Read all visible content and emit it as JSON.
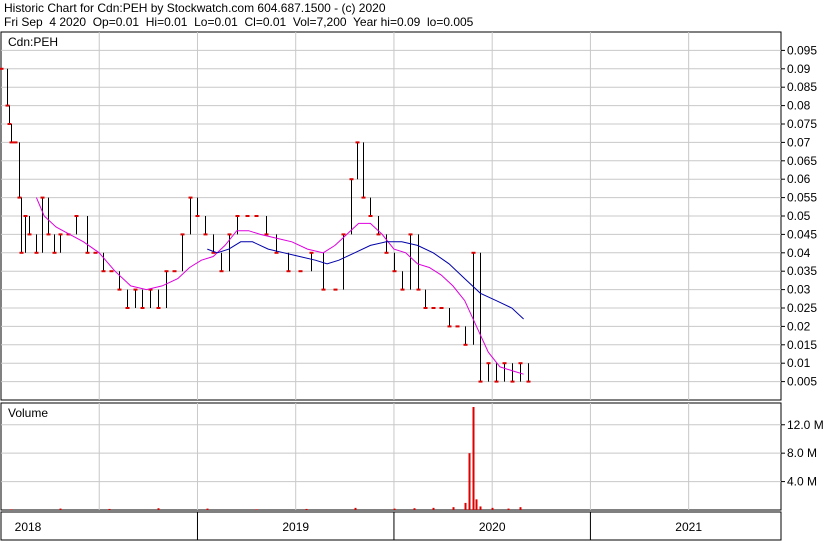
{
  "header": {
    "line1": "Historic Chart for Cdn:PEH by Stockwatch.com 604.687.1500 - (c) 2020",
    "line2": "Fri Sep  4 2020  Op=0.01  Hi=0.01  Lo=0.01  Cl=0.01  Vol=7,200  Year hi=0.09  lo=0.005"
  },
  "colors": {
    "price_up": "#000000",
    "price_down": "#dd0000",
    "ma_short": "#dd00dd",
    "ma_long": "#0000aa",
    "volume": "#dd0000",
    "grid": "#c8c8c8"
  },
  "chart_data": [
    {
      "type": "line",
      "title": "Cdn:PEH",
      "y_axis_side": "right",
      "ylim": [
        0,
        0.1
      ],
      "yticks": [
        "0.095",
        "0.09",
        "0.085",
        "0.08",
        "0.075",
        "0.07",
        "0.065",
        "0.06",
        "0.055",
        "0.05",
        "0.045",
        "0.04",
        "0.035",
        "0.03",
        "0.025",
        "0.02",
        "0.015",
        "0.01",
        "0.005"
      ],
      "grid": true,
      "series": [
        {
          "kind": "price-bars",
          "points": [
            [
              2018.0,
              0.09
            ],
            [
              2018.03,
              0.08
            ],
            [
              2018.04,
              0.075
            ],
            [
              2018.05,
              0.07
            ],
            [
              2018.07,
              0.07
            ],
            [
              2018.09,
              0.055
            ],
            [
              2018.1,
              0.04
            ],
            [
              2018.12,
              0.05
            ],
            [
              2018.14,
              0.045
            ],
            [
              2018.18,
              0.04
            ],
            [
              2018.21,
              0.055
            ],
            [
              2018.24,
              0.045
            ],
            [
              2018.27,
              0.04
            ],
            [
              2018.3,
              0.045
            ],
            [
              2018.34,
              0.045
            ],
            [
              2018.38,
              0.05
            ],
            [
              2018.44,
              0.04
            ],
            [
              2018.48,
              0.04
            ],
            [
              2018.52,
              0.035
            ],
            [
              2018.56,
              0.035
            ],
            [
              2018.6,
              0.03
            ],
            [
              2018.64,
              0.025
            ],
            [
              2018.68,
              0.03
            ],
            [
              2018.72,
              0.025
            ],
            [
              2018.76,
              0.03
            ],
            [
              2018.8,
              0.025
            ],
            [
              2018.84,
              0.035
            ],
            [
              2018.88,
              0.035
            ],
            [
              2018.92,
              0.045
            ],
            [
              2018.96,
              0.055
            ],
            [
              2019.0,
              0.05
            ],
            [
              2019.04,
              0.045
            ],
            [
              2019.08,
              0.04
            ],
            [
              2019.12,
              0.035
            ],
            [
              2019.16,
              0.045
            ],
            [
              2019.2,
              0.05
            ],
            [
              2019.25,
              0.05
            ],
            [
              2019.3,
              0.05
            ],
            [
              2019.35,
              0.045
            ],
            [
              2019.4,
              0.04
            ],
            [
              2019.46,
              0.035
            ],
            [
              2019.52,
              0.035
            ],
            [
              2019.58,
              0.04
            ],
            [
              2019.64,
              0.03
            ],
            [
              2019.7,
              0.03
            ],
            [
              2019.74,
              0.045
            ],
            [
              2019.78,
              0.06
            ],
            [
              2019.81,
              0.07
            ],
            [
              2019.84,
              0.055
            ],
            [
              2019.88,
              0.05
            ],
            [
              2019.92,
              0.045
            ],
            [
              2019.96,
              0.04
            ],
            [
              2020.0,
              0.035
            ],
            [
              2020.04,
              0.03
            ],
            [
              2020.08,
              0.045
            ],
            [
              2020.12,
              0.03
            ],
            [
              2020.16,
              0.025
            ],
            [
              2020.2,
              0.025
            ],
            [
              2020.24,
              0.025
            ],
            [
              2020.28,
              0.02
            ],
            [
              2020.32,
              0.02
            ],
            [
              2020.36,
              0.015
            ],
            [
              2020.4,
              0.04
            ],
            [
              2020.44,
              0.005
            ],
            [
              2020.48,
              0.01
            ],
            [
              2020.52,
              0.005
            ],
            [
              2020.56,
              0.01
            ],
            [
              2020.6,
              0.005
            ],
            [
              2020.64,
              0.01
            ],
            [
              2020.68,
              0.005
            ]
          ]
        },
        {
          "kind": "ma-short",
          "points": [
            [
              2018.18,
              0.055
            ],
            [
              2018.22,
              0.05
            ],
            [
              2018.28,
              0.047
            ],
            [
              2018.35,
              0.045
            ],
            [
              2018.42,
              0.043
            ],
            [
              2018.5,
              0.04
            ],
            [
              2018.58,
              0.035
            ],
            [
              2018.66,
              0.031
            ],
            [
              2018.74,
              0.03
            ],
            [
              2018.82,
              0.031
            ],
            [
              2018.9,
              0.033
            ],
            [
              2018.96,
              0.036
            ],
            [
              2019.02,
              0.038
            ],
            [
              2019.08,
              0.039
            ],
            [
              2019.14,
              0.042
            ],
            [
              2019.2,
              0.046
            ],
            [
              2019.26,
              0.046
            ],
            [
              2019.32,
              0.045
            ],
            [
              2019.4,
              0.044
            ],
            [
              2019.48,
              0.043
            ],
            [
              2019.56,
              0.041
            ],
            [
              2019.64,
              0.04
            ],
            [
              2019.7,
              0.042
            ],
            [
              2019.76,
              0.045
            ],
            [
              2019.82,
              0.048
            ],
            [
              2019.88,
              0.048
            ],
            [
              2019.94,
              0.045
            ],
            [
              2020.0,
              0.041
            ],
            [
              2020.06,
              0.04
            ],
            [
              2020.12,
              0.037
            ],
            [
              2020.18,
              0.036
            ],
            [
              2020.24,
              0.034
            ],
            [
              2020.3,
              0.031
            ],
            [
              2020.36,
              0.027
            ],
            [
              2020.42,
              0.02
            ],
            [
              2020.48,
              0.013
            ],
            [
              2020.54,
              0.009
            ],
            [
              2020.6,
              0.008
            ],
            [
              2020.66,
              0.007
            ]
          ]
        },
        {
          "kind": "ma-long",
          "points": [
            [
              2019.05,
              0.041
            ],
            [
              2019.1,
              0.04
            ],
            [
              2019.16,
              0.041
            ],
            [
              2019.22,
              0.043
            ],
            [
              2019.28,
              0.043
            ],
            [
              2019.36,
              0.041
            ],
            [
              2019.44,
              0.04
            ],
            [
              2019.52,
              0.039
            ],
            [
              2019.6,
              0.038
            ],
            [
              2019.66,
              0.037
            ],
            [
              2019.72,
              0.038
            ],
            [
              2019.8,
              0.04
            ],
            [
              2019.88,
              0.042
            ],
            [
              2019.96,
              0.043
            ],
            [
              2020.04,
              0.043
            ],
            [
              2020.12,
              0.042
            ],
            [
              2020.2,
              0.04
            ],
            [
              2020.28,
              0.037
            ],
            [
              2020.36,
              0.033
            ],
            [
              2020.44,
              0.029
            ],
            [
              2020.52,
              0.027
            ],
            [
              2020.6,
              0.025
            ],
            [
              2020.66,
              0.022
            ]
          ]
        }
      ]
    },
    {
      "type": "bar",
      "title": "Volume",
      "y_axis_side": "right",
      "ylim": [
        0,
        14.5
      ],
      "yticks": [
        "12.0 M",
        "8.0 M",
        "4.0 M"
      ],
      "unit": "M",
      "x": [
        2018.05,
        2018.3,
        2018.55,
        2018.8,
        2019.05,
        2019.3,
        2019.55,
        2019.8,
        2020.0,
        2020.1,
        2020.2,
        2020.3,
        2020.36,
        2020.38,
        2020.4,
        2020.42,
        2020.44,
        2020.5,
        2020.58,
        2020.64
      ],
      "values": [
        0.1,
        0.2,
        0.15,
        0.25,
        0.2,
        0.1,
        0.15,
        0.3,
        0.2,
        0.25,
        0.3,
        0.4,
        1.0,
        8.0,
        14.5,
        1.5,
        0.5,
        0.3,
        0.2,
        0.4
      ]
    }
  ],
  "x_axis": {
    "labels": [
      "2018",
      "2019",
      "2020",
      "2021"
    ]
  }
}
